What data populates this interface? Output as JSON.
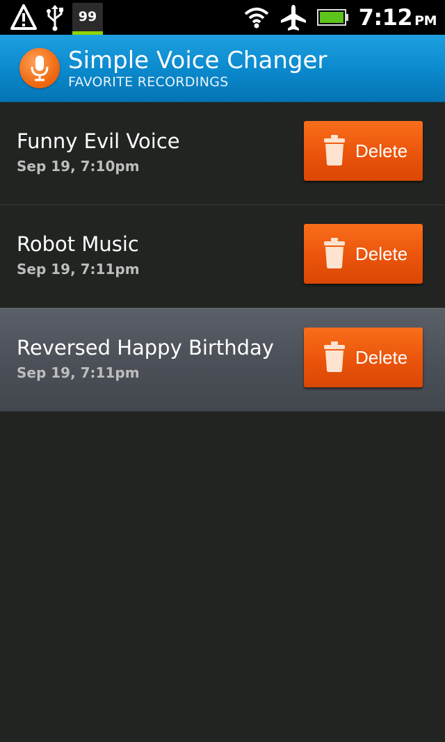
{
  "status_bar": {
    "notification_count": "99",
    "time": "7:12",
    "ampm": "PM",
    "icons": [
      "warning-triangle-icon",
      "usb-icon",
      "wifi-icon",
      "airplane-icon",
      "battery-icon"
    ]
  },
  "header": {
    "title": "Simple Voice Changer",
    "subtitle": "FAVORITE RECORDINGS",
    "logo_icon": "microphone-icon"
  },
  "recordings": [
    {
      "title": "Funny Evil Voice",
      "date": "Sep 19, 7:10pm",
      "delete_label": "Delete"
    },
    {
      "title": "Robot Music",
      "date": "Sep 19, 7:11pm",
      "delete_label": "Delete"
    },
    {
      "title": "Reversed Happy Birthday",
      "date": "Sep 19, 7:11pm",
      "delete_label": "Delete",
      "selected": true
    }
  ],
  "colors": {
    "accent_orange": "#e9520a",
    "header_blue": "#0a88cc",
    "background": "#212421"
  }
}
